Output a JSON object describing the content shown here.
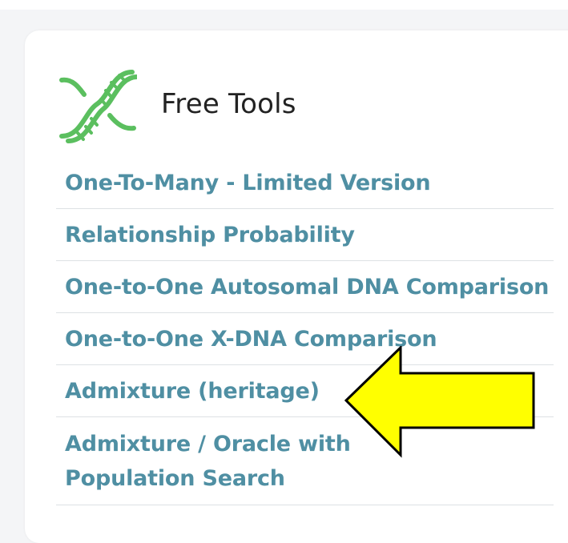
{
  "panel": {
    "title": "Free Tools",
    "icon": "dna-helix-icon",
    "accent_color": "#5bbf5f"
  },
  "tools": [
    {
      "label": "One-To-Many - Limited Version"
    },
    {
      "label": "Relationship Probability"
    },
    {
      "label": "One-to-One Autosomal DNA Comparison"
    },
    {
      "label": "One-to-One X-DNA Comparison"
    },
    {
      "label": "Admixture (heritage)"
    },
    {
      "label": "Admixture / Oracle with Population Search"
    }
  ],
  "colors": {
    "link": "#4f8fa3",
    "annotation_arrow": "#ffff00"
  },
  "annotation": {
    "icon": "left-arrow-icon",
    "points_to": "Admixture (heritage)"
  }
}
